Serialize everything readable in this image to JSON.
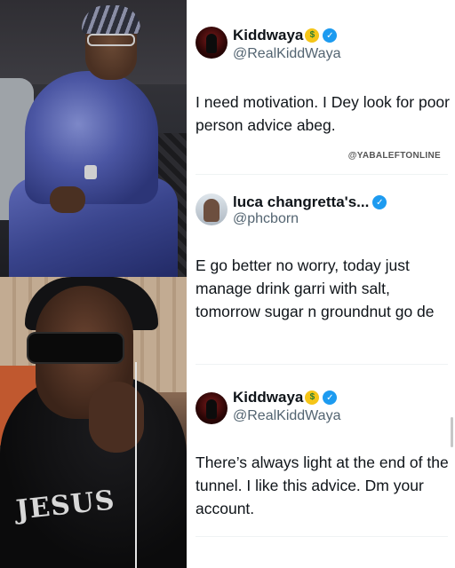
{
  "tweets": [
    {
      "name": "Kiddwaya",
      "emoji": "money-mouth-face",
      "handle": "@RealKiddWaya",
      "text": "I need motivation. I Dey look for poor person advice abeg."
    },
    {
      "name": "luca changretta's...",
      "handle": "@phcborn",
      "text": "E go better no worry, today just manage drink garri with salt, tomorrow sugar n groundnut go de"
    },
    {
      "name": "Kiddwaya",
      "emoji": "money-mouth-face",
      "handle": "@RealKiddWaya",
      "text": "There’s always light at the end of the tunnel. I like this advice. Dm your account."
    }
  ],
  "watermark": "@YABALEFTONLINE",
  "photo_graphic_text": "JESUS",
  "colors": {
    "verified": "#1d9bf0",
    "handle": "#536471",
    "text": "#0f1419"
  },
  "icons": [
    "verified-badge-icon",
    "money-mouth-emoji-icon"
  ]
}
